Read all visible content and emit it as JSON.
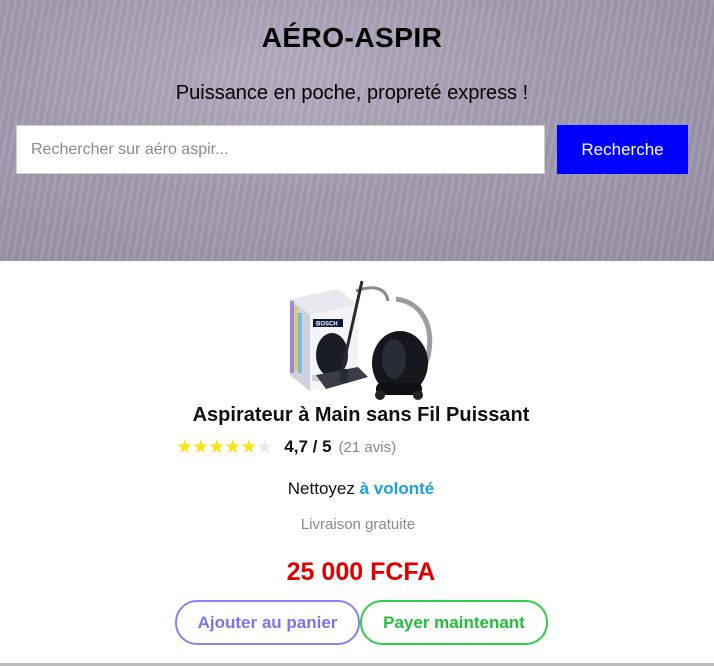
{
  "header": {
    "brand": "AÉRO-ASPIR",
    "tagline": "Puissance en poche, propreté express !"
  },
  "search": {
    "placeholder": "Rechercher sur aéro aspir...",
    "value": "",
    "button_label": "Recherche"
  },
  "product": {
    "image_icon": "vacuum-cleaner-product-image",
    "image_brand_text": "BOSCH",
    "title": "Aspirateur à Main sans Fil Puissant",
    "rating": {
      "stars_filled": 5,
      "stars_total": 6,
      "score": "4,7 / 5",
      "reviews": "(21 avis)"
    },
    "promo_prefix": "Nettoyez",
    "promo_highlight": "à volonté",
    "delivery": "Livraison gratuite",
    "price": "25 000 FCFA"
  },
  "actions": {
    "add_to_cart": "Ajouter au panier",
    "pay_now": "Payer maintenant"
  },
  "colors": {
    "search_button": "#0000ff",
    "price": "#e00000",
    "promo_highlight": "#1a9fe6",
    "cart_button": "#7d72ee",
    "pay_button": "#22c03a",
    "star_filled": "#f7e21a"
  }
}
